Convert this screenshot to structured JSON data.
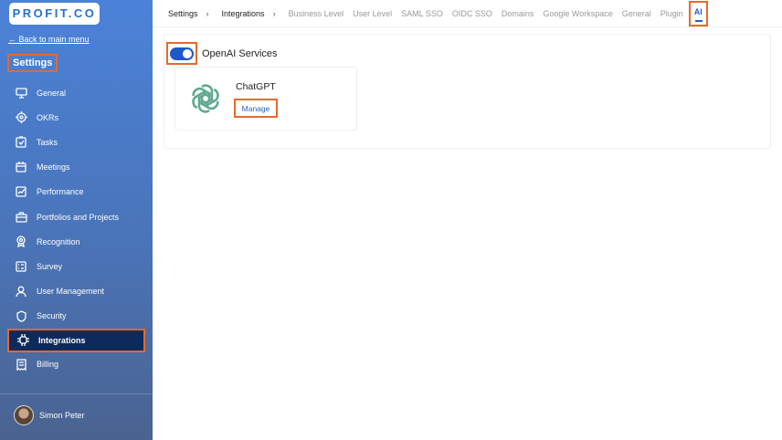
{
  "sidebar": {
    "logo": "PROFIT.CO",
    "back": "← Back to main menu",
    "title": "Settings",
    "items": [
      {
        "label": "General"
      },
      {
        "label": "OKRs"
      },
      {
        "label": "Tasks"
      },
      {
        "label": "Meetings"
      },
      {
        "label": "Performance"
      },
      {
        "label": "Portfolios and Projects"
      },
      {
        "label": "Recognition"
      },
      {
        "label": "Survey"
      },
      {
        "label": "User Management"
      },
      {
        "label": "Security"
      },
      {
        "label": "Integrations"
      },
      {
        "label": "Billing"
      }
    ],
    "user": "Simon Peter"
  },
  "breadcrumb": [
    "Settings",
    "Integrations"
  ],
  "tabs": [
    "Business Level",
    "User Level",
    "SAML SSO",
    "OIDC SSO",
    "Domains",
    "Google Workspace",
    "General",
    "Plugin",
    "AI"
  ],
  "main": {
    "service": "OpenAI Services",
    "toggle_on": true,
    "card_title": "ChatGPT",
    "manage": "Manage"
  },
  "colors": {
    "accent": "#1b5ac8",
    "highlight": "#e8692b",
    "openai": "#5ea98f"
  }
}
